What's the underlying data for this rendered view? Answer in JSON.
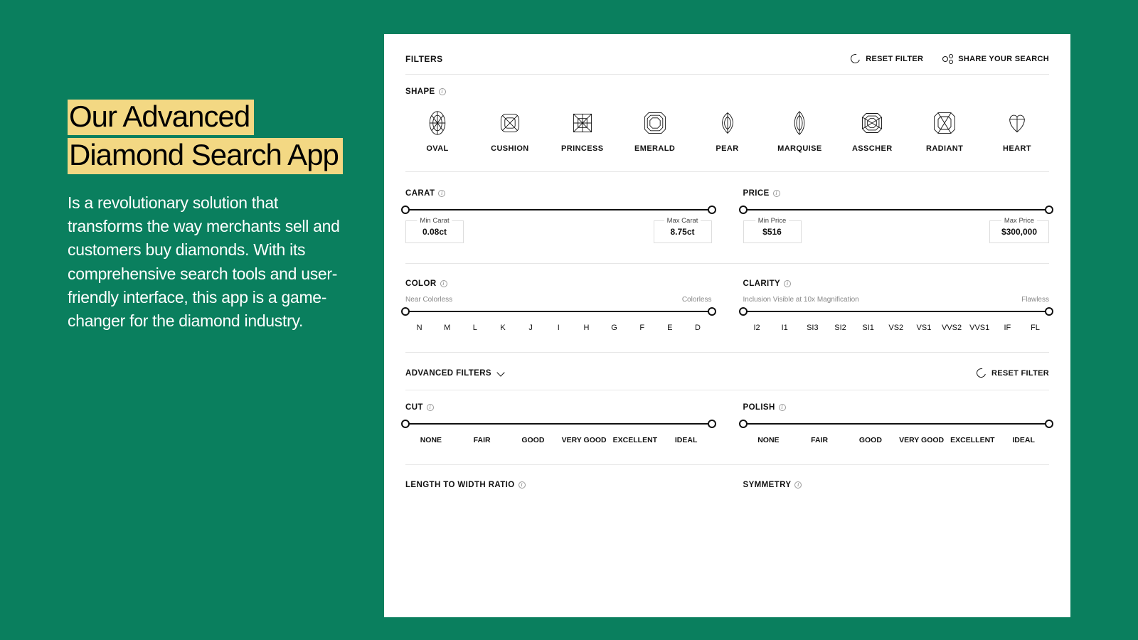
{
  "promo": {
    "heading_line1": "Our Advanced",
    "heading_line2": "Diamond Search App",
    "body": "Is a revolutionary solution that transforms the way merchants sell and customers buy diamonds. With its comprehensive search tools and user-friendly interface, this app is a game-changer for the diamond industry."
  },
  "panel": {
    "filters_label": "FILTERS",
    "reset_label": "RESET FILTER",
    "share_label": "SHARE YOUR SEARCH",
    "shape": {
      "label": "SHAPE",
      "items": [
        "OVAL",
        "CUSHION",
        "PRINCESS",
        "EMERALD",
        "PEAR",
        "MARQUISE",
        "ASSCHER",
        "RADIANT",
        "HEART"
      ]
    },
    "carat": {
      "label": "CARAT",
      "min_label": "Min Carat",
      "min_value": "0.08ct",
      "max_label": "Max Carat",
      "max_value": "8.75ct"
    },
    "price": {
      "label": "PRICE",
      "min_label": "Min Price",
      "min_value": "$516",
      "max_label": "Max Price",
      "max_value": "$300,000"
    },
    "color": {
      "label": "COLOR",
      "left_text": "Near Colorless",
      "right_text": "Colorless",
      "ticks": [
        "N",
        "M",
        "L",
        "K",
        "J",
        "I",
        "H",
        "G",
        "F",
        "E",
        "D"
      ]
    },
    "clarity": {
      "label": "CLARITY",
      "left_text": "Inclusion Visible at 10x Magnification",
      "right_text": "Flawless",
      "ticks": [
        "I2",
        "I1",
        "SI3",
        "SI2",
        "SI1",
        "VS2",
        "VS1",
        "VVS2",
        "VVS1",
        "IF",
        "FL"
      ]
    },
    "advanced": {
      "label": "ADVANCED FILTERS",
      "reset_label": "RESET FILTER"
    },
    "cut": {
      "label": "CUT",
      "ticks": [
        "NONE",
        "FAIR",
        "GOOD",
        "VERY GOOD",
        "EXCELLENT",
        "IDEAL"
      ]
    },
    "polish": {
      "label": "POLISH",
      "ticks": [
        "NONE",
        "FAIR",
        "GOOD",
        "VERY GOOD",
        "EXCELLENT",
        "IDEAL"
      ]
    },
    "ratio": {
      "label": "LENGTH TO WIDTH RATIO"
    },
    "symmetry": {
      "label": "SYMMETRY"
    }
  }
}
